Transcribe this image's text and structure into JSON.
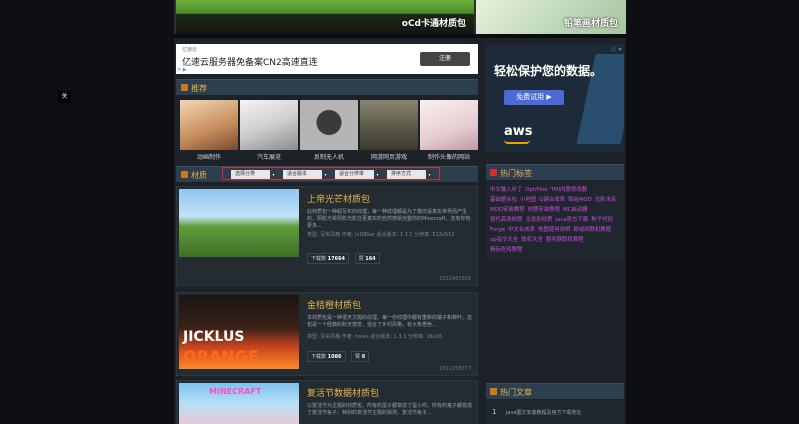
{
  "overlay": {
    "close_label": "关"
  },
  "banners": [
    {
      "title": "oCd卡通材质包"
    },
    {
      "title": "铅笔画材质包"
    }
  ],
  "ad_left": {
    "small": "亿速云",
    "text": "亿速云服务器免备案CN2高速直连",
    "button": "注册",
    "corner": "✕ ▶"
  },
  "ad_right": {
    "title": "轻松保护您的数据。",
    "button": "免费试用 ▶",
    "logo": "aws",
    "badge": "ⓘ ✕"
  },
  "recommend": {
    "heading": "推荐",
    "items": [
      {
        "caption": "动画制作",
        "color": "#c9a27a"
      },
      {
        "caption": "汽车展览",
        "color": "#dcdcdc"
      },
      {
        "caption": "反制无人机",
        "color": "#8e8e8e"
      },
      {
        "caption": "网游网页游戏",
        "color": "#6b6a5a"
      },
      {
        "caption": "制作头像的网站",
        "color": "#e8d6d8"
      }
    ]
  },
  "materials": {
    "heading": "材质",
    "filters": [
      "选择分类",
      "适合版本",
      "适合分辨率",
      "排序方式"
    ],
    "caret": "▾"
  },
  "cards": [
    {
      "title": "上帝光芒材质包",
      "desc": "此材质包一种超写实的纹理，每一种纹理都是为了模仿逼真实世界而产生的，阴影光晕阴影光影在更真实的自然感受完整你的Minecraft，还有你有更多...",
      "meta": "类型: 写实风格   作者: lvDBSer   适合版本: 1.3.1   分辨率: 512x512",
      "downloads_label": "下载数",
      "downloads": "17664",
      "likes_label": "赞",
      "likes": "164",
      "id": "1552483801"
    },
    {
      "title": "金桔橙材质包",
      "desc": "本材质包是一种很天文题的纹理。每一份纹理中都有重新的橘子和棉叶。这包是一个经典的秋天感觉，混合了乡村风格，有大象橙色...",
      "meta": "类型: 写实风格   作者: holve   适合版本: 1.3.1   分辨率: 16x16",
      "downloads_label": "下载数",
      "downloads": "1086",
      "likes_label": "赞",
      "likes": "6",
      "id": "1552258077",
      "thumb_text_1": "JICKLUS",
      "thumb_text_2": "ORANGE"
    },
    {
      "title": "复活节数据材质包",
      "desc": "以复活节为主题的材质包，所有的蛋子都变成了蛋小鸡，所有的鬼子都变成了复活节兔子，特别的复活节主题的猜测，复活节兔子...",
      "meta": "",
      "downloads_label": "",
      "downloads": "",
      "likes_label": "",
      "likes": "",
      "id": "",
      "thumb_text_1": "MINECRAFT"
    }
  ],
  "hot_tags": {
    "heading": "热门标签",
    "tags": [
      "中文输入补丁",
      "OptiFine",
      "TMI内置修改器",
      "基础整合包",
      "小地图",
      "G键合成表",
      "铁砧MOD",
      "光影水反",
      "MOD安装教程",
      "材质安装教程",
      "MC启动器",
      "现代高清材质",
      "主设形材质",
      "java官方下载",
      "种子代码",
      "Forge",
      "中文合成表",
      "地图使用说明",
      "局域网联机教程",
      "op指令大全",
      "联机大全",
      "服务器联机教程",
      "畅玩吃鸡教程"
    ]
  },
  "hot_articles": {
    "heading": "热门文章",
    "items": [
      {
        "n": "1",
        "title": "java图文安装教程及官方下载地址"
      }
    ]
  }
}
